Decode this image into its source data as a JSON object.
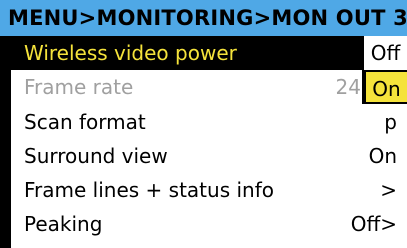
{
  "header": {
    "title": "MENU>MONITORING>MON OUT 3"
  },
  "menu": {
    "items": [
      {
        "label": "Wireless video power",
        "value": ""
      },
      {
        "label": "Frame rate",
        "value": "24"
      },
      {
        "label": "Scan format",
        "value": "p"
      },
      {
        "label": "Surround view",
        "value": "On"
      },
      {
        "label": "Frame lines + status info",
        "value": ">"
      },
      {
        "label": "Peaking",
        "value": "Off>"
      }
    ]
  },
  "popup": {
    "options": [
      "Off",
      "On"
    ],
    "selected": "On"
  },
  "colors": {
    "header_bg": "#4fa8e6",
    "selection_text": "#f5e33b",
    "selection_bg": "#000000",
    "disabled_text": "#a0a0a0"
  }
}
